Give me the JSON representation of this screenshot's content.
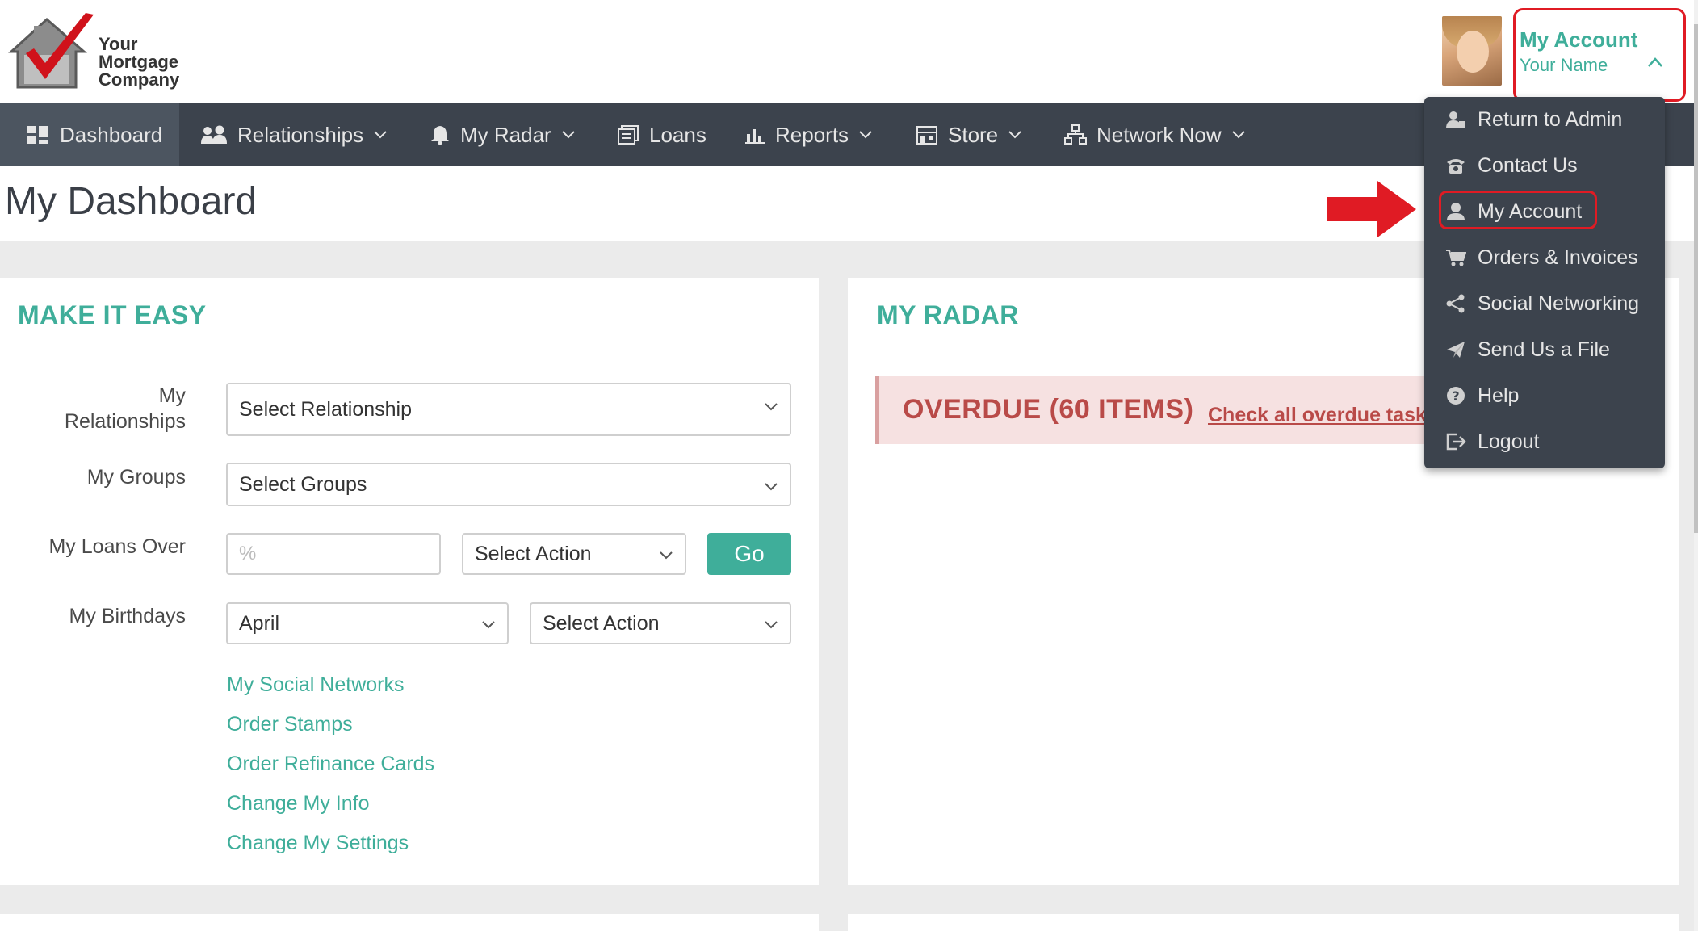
{
  "header": {
    "logo_text_line1": "Your",
    "logo_text_line2": "Mortgage",
    "logo_text_line3": "Company",
    "account_title": "My Account",
    "account_name": "Your Name"
  },
  "nav": {
    "items": [
      {
        "label": "Dashboard",
        "icon": "dashboard-icon"
      },
      {
        "label": "Relationships",
        "icon": "users-icon"
      },
      {
        "label": "My Radar",
        "icon": "bell-icon"
      },
      {
        "label": "Loans",
        "icon": "documents-icon"
      },
      {
        "label": "Reports",
        "icon": "bar-chart-icon"
      },
      {
        "label": "Store",
        "icon": "store-icon"
      },
      {
        "label": "Network Now",
        "icon": "network-icon"
      }
    ]
  },
  "page": {
    "title": "My Dashboard"
  },
  "make_it_easy": {
    "heading": "MAKE IT EASY",
    "relationships_label_line1": "My",
    "relationships_label_line2": "Relationships",
    "relationships_select": "Select Relationship",
    "groups_label": "My Groups",
    "groups_select": "Select Groups",
    "loans_label": "My Loans Over",
    "loans_placeholder": "%",
    "loans_action_select": "Select Action",
    "go_label": "Go",
    "birthdays_label": "My Birthdays",
    "birthdays_month": "April",
    "birthdays_action_select": "Select Action",
    "links": [
      "My Social Networks",
      "Order Stamps",
      "Order Refinance Cards",
      "Change My Info",
      "Change My Settings"
    ]
  },
  "my_radar": {
    "heading": "MY RADAR",
    "overdue_title": "OVERDUE (60 ITEMS)",
    "overdue_link": "Check all overdue tasks"
  },
  "account_menu": {
    "items": [
      {
        "label": "Return to Admin",
        "icon": "user-admin-icon"
      },
      {
        "label": "Contact Us",
        "icon": "phone-icon"
      },
      {
        "label": "My Account",
        "icon": "user-icon"
      },
      {
        "label": "Orders & Invoices",
        "icon": "cart-icon"
      },
      {
        "label": "Social Networking",
        "icon": "share-icon"
      },
      {
        "label": "Send Us a File",
        "icon": "paper-plane-icon"
      },
      {
        "label": "Help",
        "icon": "help-icon"
      },
      {
        "label": "Logout",
        "icon": "logout-icon"
      }
    ]
  },
  "colors": {
    "accent": "#3fae9a",
    "nav_bg": "#3c434d",
    "highlight": "#e01b24",
    "overdue": "#b94a48"
  }
}
